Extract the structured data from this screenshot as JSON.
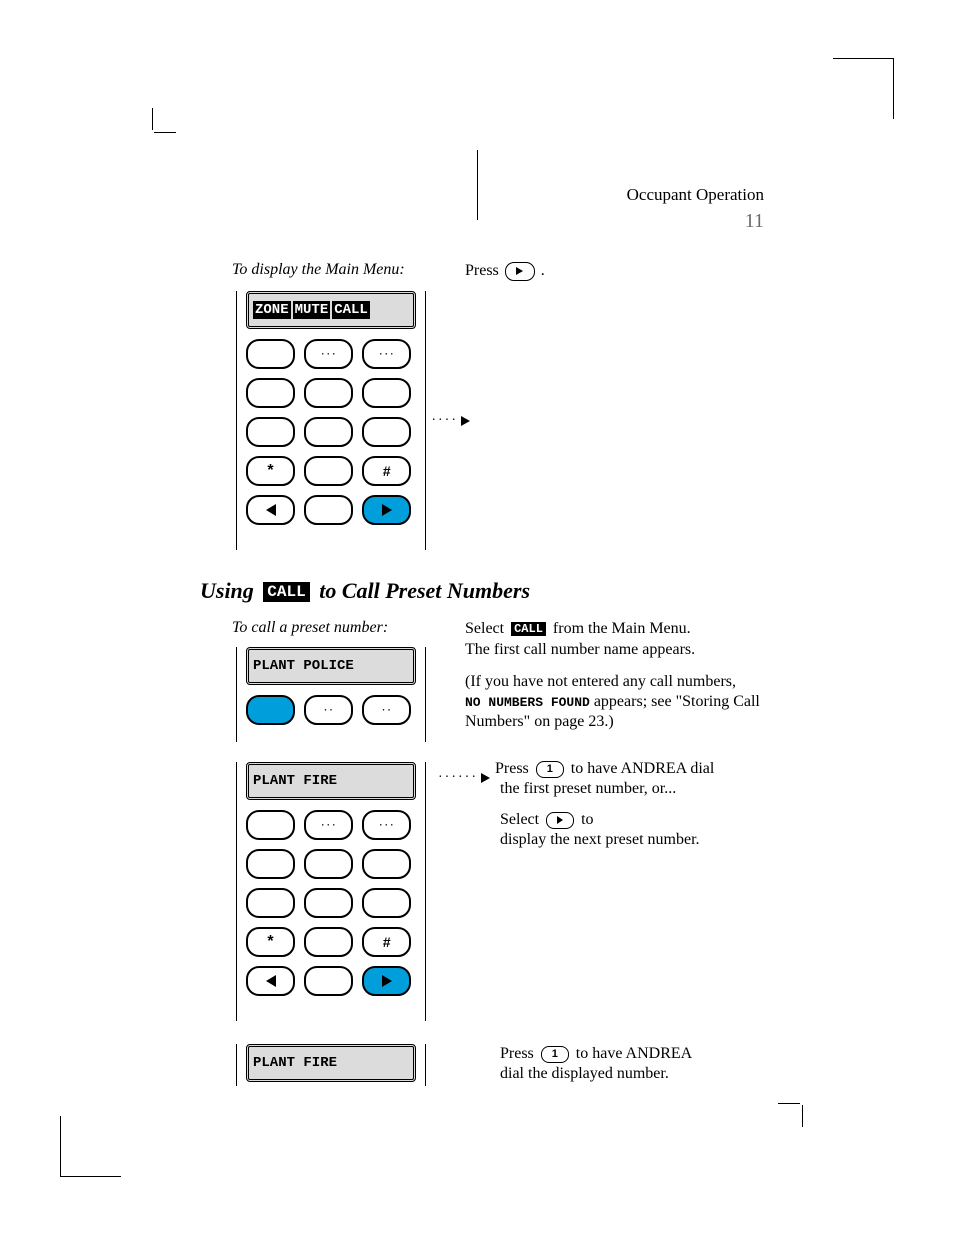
{
  "header": {
    "right": "Occupant Operation",
    "page": "11"
  },
  "section1": {
    "instruction": "To display the Main Menu:",
    "action1_pre": "Press",
    "action1_icon": "forward",
    "action1_post": "."
  },
  "device1": {
    "lcd": [
      "ZONE",
      "MUTE",
      "CALL"
    ]
  },
  "callout1": {
    "title_pre": "Using",
    "title_post": "to Call Preset Numbers",
    "title_mono": "CALL",
    "to_pre": "To call a preset number:",
    "step_pre": "Select",
    "step_mono": "CALL",
    "step_post": "from the Main Menu.",
    "result": "The first call number name appears.",
    "para2_l1": "(If you have not entered any call numbers,",
    "para2_l2_mono": "NO NUMBERS FOUND",
    "para2_l2_post": "appears; see \"Storing Call",
    "para2_l3": "Numbers\" on page 23.)"
  },
  "device2a": {
    "lcd_plain": "PLANT POLICE"
  },
  "section2b": {
    "step_pre": "Press",
    "step_mono": "1",
    "step_post": "to have ANDREA dial",
    "step_post2": "the first preset number, or...",
    "step2_pre": "Select",
    "step2_icon": "forward",
    "step2_post": "to",
    "step2_post2": "display the next preset number."
  },
  "device2b": {
    "lcd_plain": "PLANT FIRE"
  },
  "section3": {
    "step_pre": "Press",
    "step_mono": "1",
    "step_post": "to have ANDREA",
    "step_post2": "dial the displayed number."
  },
  "device3": {
    "lcd_plain": "PLANT FIRE"
  },
  "colors": {
    "accent": "#009fdb"
  }
}
